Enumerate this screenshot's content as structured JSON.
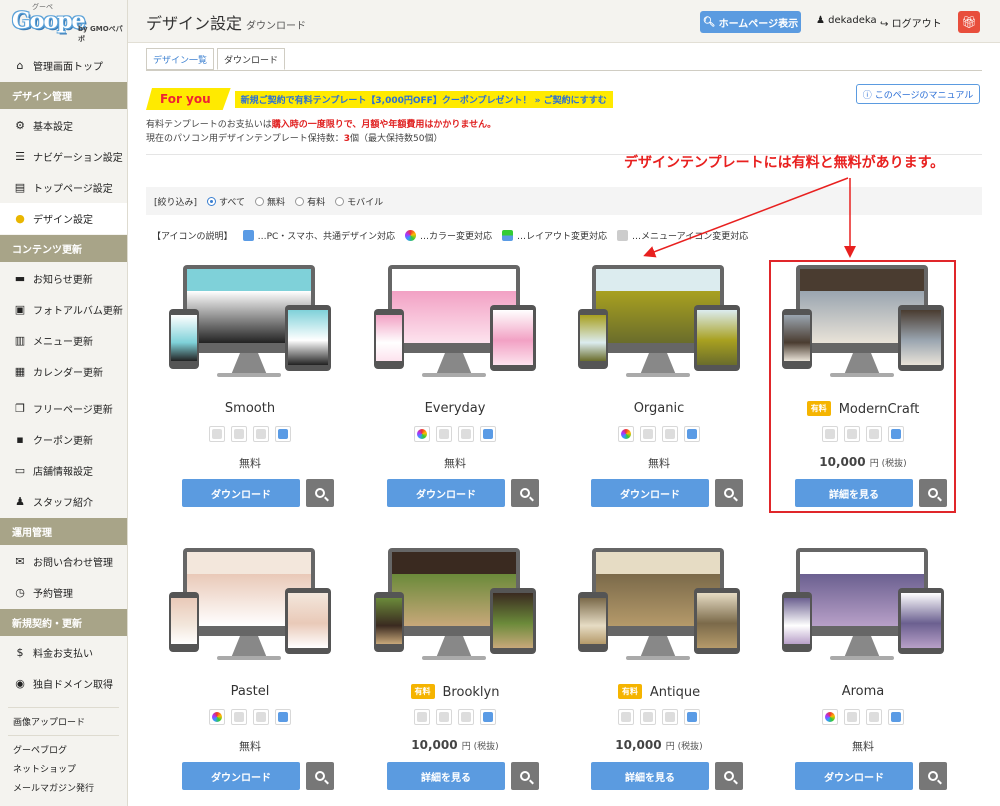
{
  "logo": {
    "kana": "グーペ",
    "mark": "Goope",
    "by": "by GMOペパボ"
  },
  "sidebar": {
    "top_item": {
      "label": "管理画面トップ",
      "icon": "home-icon"
    },
    "sections": [
      {
        "title": "デザイン管理",
        "items": [
          {
            "label": "基本設定",
            "icon": "gear-icon"
          },
          {
            "label": "ナビゲーション設定",
            "icon": "list-icon"
          },
          {
            "label": "トップページ設定",
            "icon": "page-icon"
          },
          {
            "label": "デザイン設定",
            "icon": "palette-icon",
            "active": true
          }
        ]
      },
      {
        "title": "コンテンツ更新",
        "items": [
          {
            "label": "お知らせ更新",
            "icon": "chat-icon"
          },
          {
            "label": "フォトアルバム更新",
            "icon": "photo-icon"
          },
          {
            "label": "メニュー更新",
            "icon": "book-icon"
          },
          {
            "label": "カレンダー更新",
            "icon": "calendar-icon"
          },
          {
            "label": "フリーページ更新",
            "icon": "copy-icon"
          },
          {
            "label": "クーポン更新",
            "icon": "grid-icon"
          },
          {
            "label": "店舗情報設定",
            "icon": "laptop-icon"
          },
          {
            "label": "スタッフ紹介",
            "icon": "person-icon"
          }
        ]
      },
      {
        "title": "運用管理",
        "items": [
          {
            "label": "お問い合わせ管理",
            "icon": "mail-icon"
          },
          {
            "label": "予約管理",
            "icon": "clock-icon"
          }
        ]
      },
      {
        "title": "新規契約・更新",
        "items": [
          {
            "label": "料金お支払い",
            "icon": "dollar-icon"
          },
          {
            "label": "独自ドメイン取得",
            "icon": "globe-icon"
          }
        ]
      }
    ],
    "bottom_links": [
      "画像アップロード",
      "グーペブログ",
      "ネットショップ",
      "メールマガジン発行"
    ]
  },
  "header": {
    "title": "デザイン設定",
    "subtitle": "ダウンロード",
    "home_button": "ホームページ表示",
    "user": "dekadeka",
    "logout": "ログアウト"
  },
  "tabs": [
    "デザイン一覧",
    "ダウンロード"
  ],
  "promo": {
    "badge": "For you",
    "message": "新規ご契約で有料テンプレート【3,000円OFF】クーポンプレゼント！ » ご契約にすすむ"
  },
  "manual_button": "このページのマニュアル",
  "info": {
    "line1_prefix": "有料テンプレートのお支払いは",
    "line1_red": "購入時の一度限りで、月額や年額費用はかかりません。",
    "line2_prefix": "現在のパソコン用デザインテンプレート保持数：",
    "line2_count": "3",
    "line2_suffix": "個（最大保持数50個）"
  },
  "annotation": "デザインテンプレートには有料と無料があります。",
  "filter": {
    "label": "[絞り込み]",
    "options": [
      "すべて",
      "無料",
      "有料",
      "モバイル"
    ],
    "selected": "すべて"
  },
  "legend": {
    "label": "【アイコンの説明】",
    "items": [
      "…PC・スマホ、共通デザイン対応",
      "…カラー変更対応",
      "…レイアウト変更対応",
      "…メニューアイコン変更対応"
    ]
  },
  "colors": {
    "accent": "#5b9be0",
    "section": "#a8a488",
    "badge": "#f5b400",
    "annotation": "#e8201f"
  },
  "templates": [
    {
      "name": "Smooth",
      "paid": false,
      "price": "無料",
      "button": "ダウンロード",
      "color": false,
      "theme": [
        "#7fd1d9",
        "#fff",
        "#222"
      ]
    },
    {
      "name": "Everyday",
      "paid": false,
      "price": "無料",
      "button": "ダウンロード",
      "color": true,
      "theme": [
        "#fff",
        "#f2a1c4",
        "#fde3ee"
      ]
    },
    {
      "name": "Organic",
      "paid": false,
      "price": "無料",
      "button": "ダウンロード",
      "color": true,
      "theme": [
        "#dcecef",
        "#a8a020",
        "#6a6d2b"
      ]
    },
    {
      "name": "ModernCraft",
      "paid": true,
      "badge": "有料",
      "price": "10,000",
      "unit": "円 (税抜)",
      "button": "詳細を見る",
      "color": false,
      "theme": [
        "#4a3c30",
        "#9aa5b0",
        "#e9e3d8"
      ]
    },
    {
      "name": "Pastel",
      "paid": false,
      "price": "無料",
      "button": "ダウンロード",
      "color": true,
      "theme": [
        "#f3e7dc",
        "#e9c9b8",
        "#fff"
      ]
    },
    {
      "name": "Brooklyn",
      "paid": true,
      "badge": "有料",
      "price": "10,000",
      "unit": "円 (税抜)",
      "button": "詳細を見る",
      "color": false,
      "theme": [
        "#3a2a20",
        "#6b8a3a",
        "#c8a87a"
      ]
    },
    {
      "name": "Antique",
      "paid": true,
      "badge": "有料",
      "price": "10,000",
      "unit": "円 (税抜)",
      "button": "詳細を見る",
      "color": false,
      "theme": [
        "#e6dcc4",
        "#7b6a4a",
        "#b59a6a"
      ]
    },
    {
      "name": "Aroma",
      "paid": false,
      "price": "無料",
      "button": "ダウンロード",
      "color": true,
      "theme": [
        "#fff",
        "#6b6090",
        "#b8a0c8"
      ]
    }
  ]
}
